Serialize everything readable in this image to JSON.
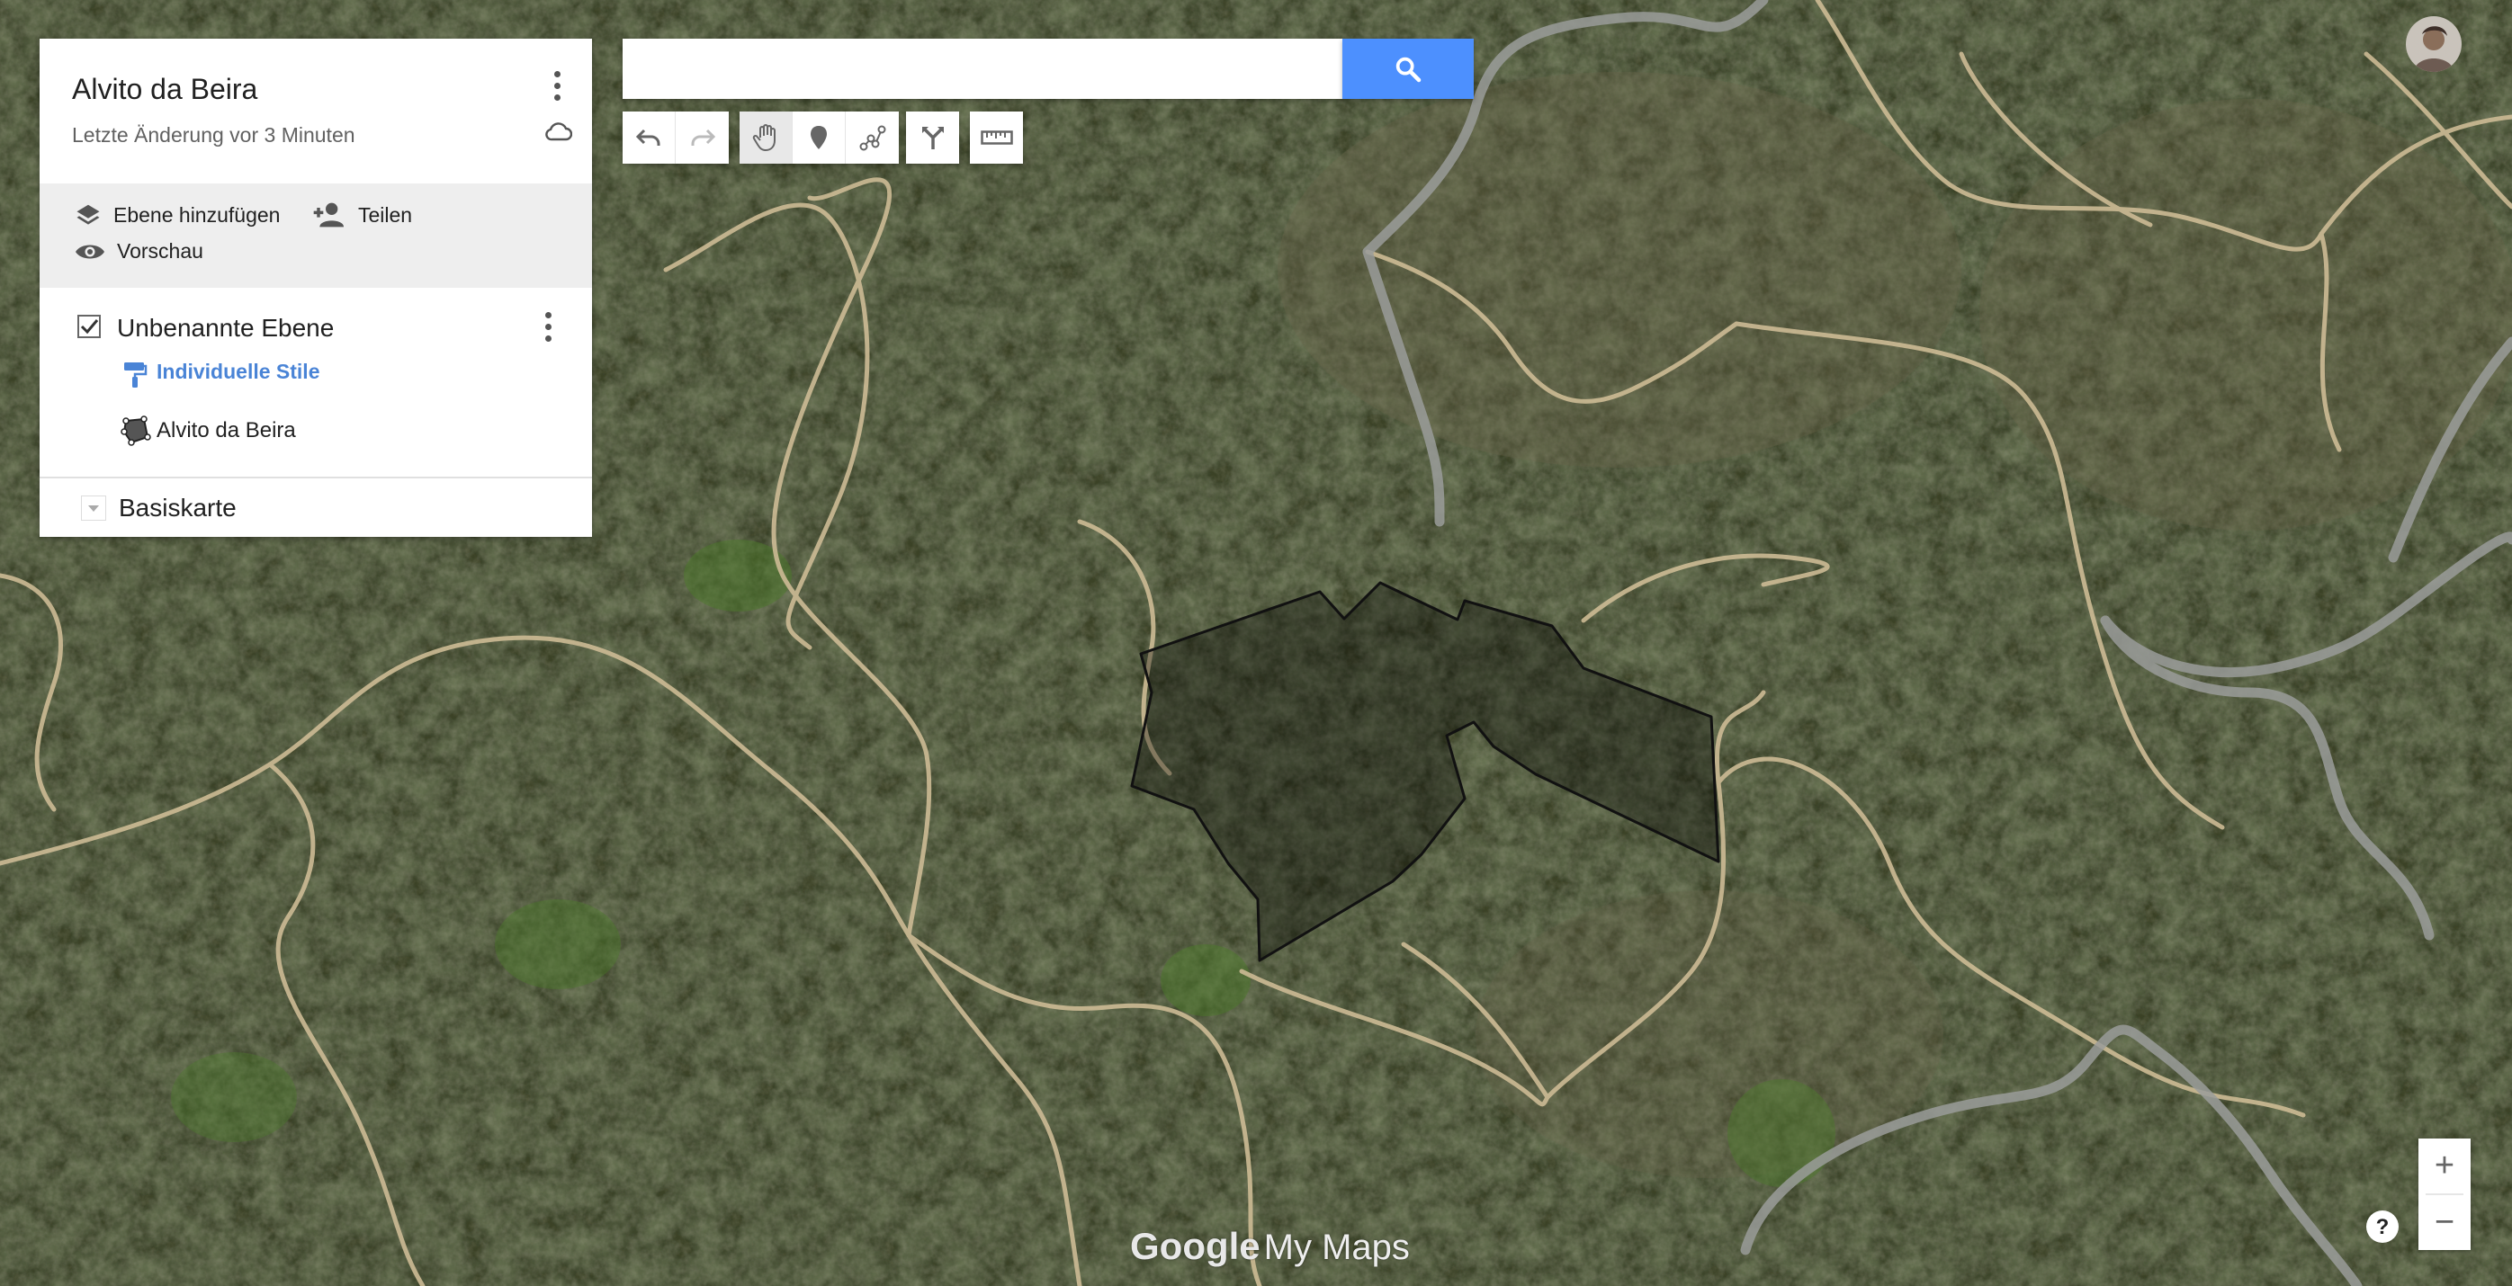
{
  "map": {
    "title": "Alvito da Beira",
    "status": "Letzte Änderung vor 3 Minuten"
  },
  "actions": {
    "add_layer": "Ebene hinzufügen",
    "share": "Teilen",
    "preview": "Vorschau"
  },
  "layer": {
    "name": "Unbenannte Ebene",
    "style_link": "Individuelle Stile",
    "feature_name": "Alvito da Beira",
    "checked": true
  },
  "basemap": {
    "label": "Basiskarte"
  },
  "search": {
    "value": "",
    "placeholder": ""
  },
  "toolbar": {
    "tools": [
      "undo-icon",
      "redo-icon",
      "hand-icon",
      "marker-icon",
      "line-icon",
      "route-icon",
      "ruler-icon"
    ],
    "active": "hand-icon"
  },
  "zoom": {
    "in": "+",
    "out": "−"
  },
  "branding": {
    "google": "Google",
    "product": "My Maps"
  },
  "colors": {
    "accent": "#4d90fe",
    "link": "#4a84d6"
  }
}
